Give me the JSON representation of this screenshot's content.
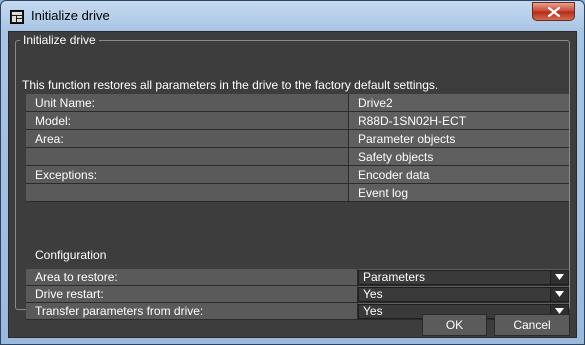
{
  "window": {
    "title": "Initialize drive"
  },
  "group": {
    "legend": "Initialize drive",
    "description": "This function restores all parameters in the drive to the factory default settings."
  },
  "info_rows": [
    {
      "label": "Unit Name:",
      "value": "Drive2"
    },
    {
      "label": "Model:",
      "value": "R88D-1SN02H-ECT"
    },
    {
      "label": "Area:",
      "value": "Parameter objects"
    },
    {
      "label": "",
      "value": "Safety objects"
    },
    {
      "label": "Exceptions:",
      "value": "Encoder data"
    },
    {
      "label": "",
      "value": "Event log"
    }
  ],
  "configuration": {
    "heading": "Configuration",
    "rows": [
      {
        "label": "Area to restore:",
        "value": "Parameters"
      },
      {
        "label": "Drive restart:",
        "value": "Yes"
      },
      {
        "label": "Transfer parameters from drive:",
        "value": "Yes"
      }
    ]
  },
  "buttons": {
    "ok": "OK",
    "cancel": "Cancel"
  },
  "icons": {
    "app": "drive-app-icon",
    "close": "close-icon",
    "dropdown": "chevron-down-icon"
  },
  "colors": {
    "title_bar": "#a9c5e4",
    "client_bg": "#3d3d3d",
    "close_button": "#c8432c"
  }
}
